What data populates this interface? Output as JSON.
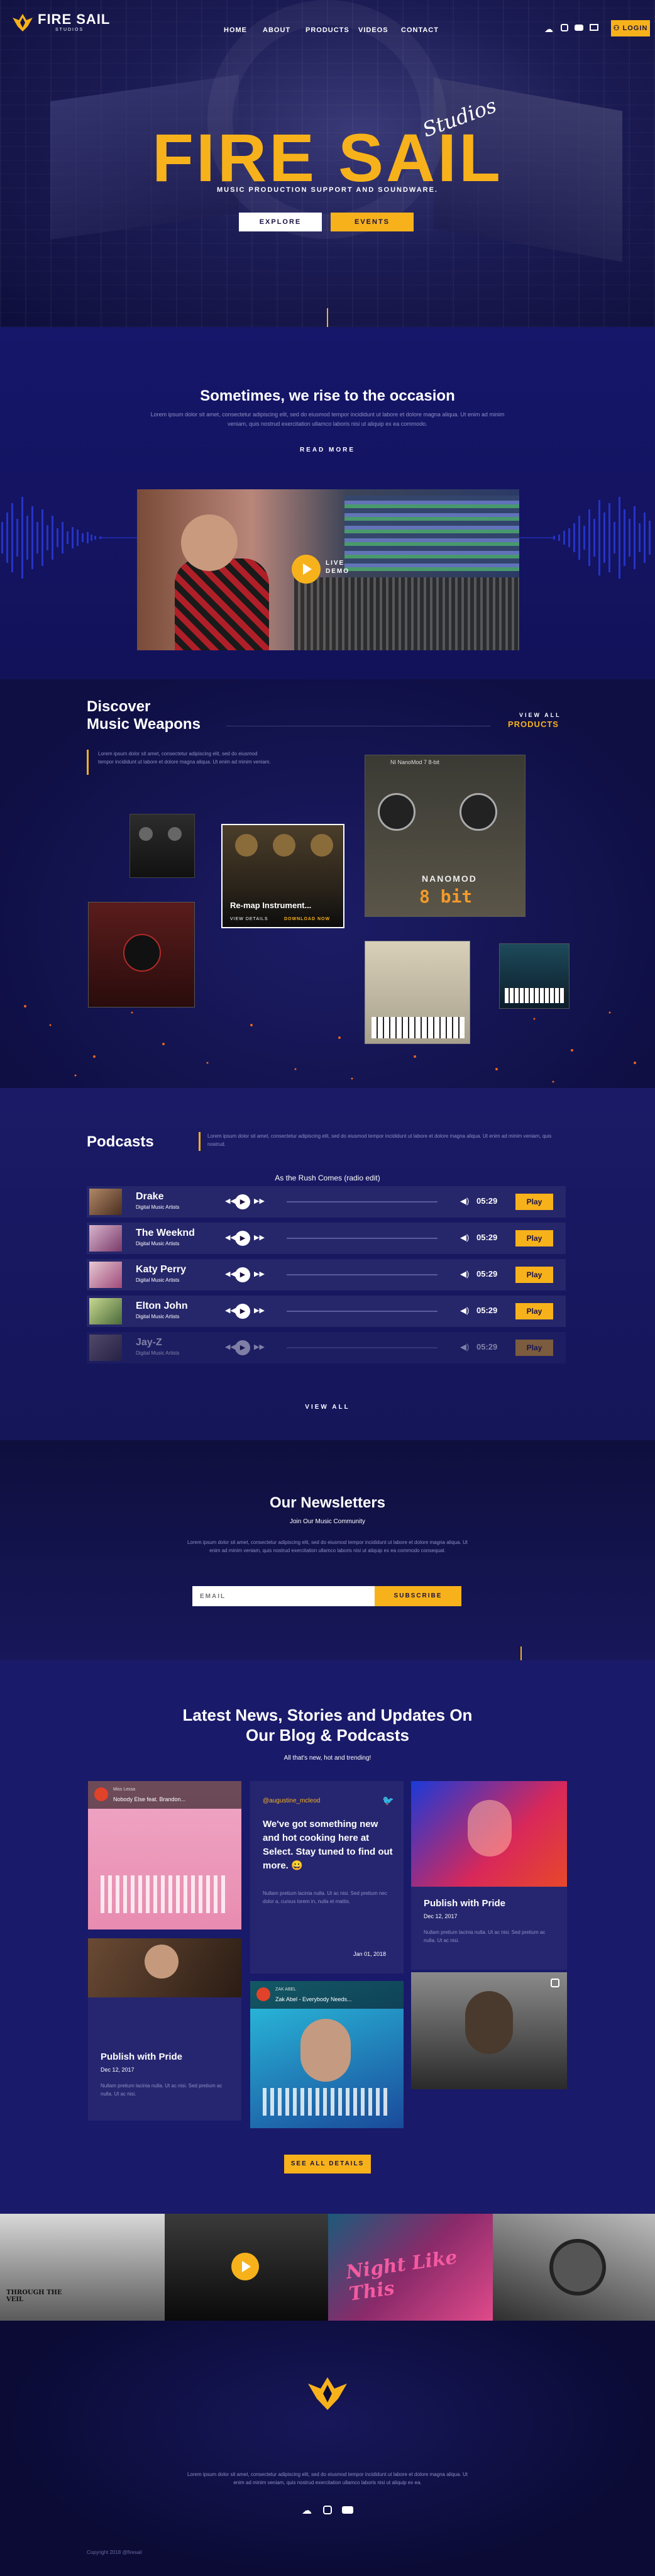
{
  "colors": {
    "accent": "#f7b21b",
    "background": "#11114a",
    "panel": "#262670",
    "wave": "#2b3be0"
  },
  "brand": {
    "name": "FIRE SAIL",
    "sub": "STUDIOS"
  },
  "nav": {
    "items": [
      "HOME",
      "ABOUT",
      "PRODUCTS",
      "VIDEOS",
      "CONTACT"
    ],
    "login": "LOGIN",
    "social_icons": [
      "soundcloud-icon",
      "instagram-icon",
      "youtube-icon",
      "mail-icon"
    ]
  },
  "hero": {
    "title": "FIRE SAIL",
    "script": "Studios",
    "subtitle": "MUSIC PRODUCTION SUPPORT AND SOUNDWARE.",
    "btn_explore": "EXPLORE",
    "btn_events": "EVENTS"
  },
  "rise": {
    "heading": "Sometimes, we rise to the occasion",
    "text": "Lorem ipsum dolor sit amet, consectetur adipiscing elit, sed do eiusmod tempor incididunt ut labore et dolore magna aliqua. Ut enim ad minim veniam, quis nostrud exercitation ullamco laboris nisi ut aliquip ex ea commodo.",
    "read_more": "READ MORE",
    "video_label_1": "LIVE",
    "video_label_2": "DEMO"
  },
  "weapons": {
    "heading_1": "Discover",
    "heading_2": "Music Weapons",
    "text": "Lorem ipsum dolor sit amet, consectetur adipiscing elit, sed do eiusmod tempor incididunt ut labore et dolore magna aliqua. Ut enim ad minim veniam.",
    "view_all_1": "VIEW ALL",
    "view_all_2": "PRODUCTS",
    "featured_title": "Re-map Instrument...",
    "featured_details": "VIEW DETAILS",
    "featured_download": "DOWNLOAD NOW",
    "plugin_brand": "NANOMOD",
    "plugin_brand_2": "8 bit",
    "plugin_header": "NI NanoMod 7 8-bit"
  },
  "podcasts": {
    "heading": "Podcasts",
    "text": "Lorem ipsum dolor sit amet, consectetur adipiscing elit, sed do eiusmod tempor incididunt ut labore et dolore magna aliqua. Ut enim ad minim veniam, quis nostrud.",
    "now_playing": "As the Rush Comes (radio edit)",
    "rows": [
      {
        "name": "Drake",
        "sub": "Digital Music Artists",
        "time": "05:29",
        "play": "Play"
      },
      {
        "name": "The Weeknd",
        "sub": "Digital Music Artists",
        "time": "05:29",
        "play": "Play"
      },
      {
        "name": "Katy Perry",
        "sub": "Digital Music Artists",
        "time": "05:29",
        "play": "Play"
      },
      {
        "name": "Elton John",
        "sub": "Digital Music Artists",
        "time": "05:29",
        "play": "Play"
      },
      {
        "name": "Jay-Z",
        "sub": "Digital Music Artists",
        "time": "05:29",
        "play": "Play"
      }
    ],
    "view_all": "VIEW ALL"
  },
  "newsletter": {
    "heading": "Our Newsletters",
    "sub": "Join Our Music Community",
    "text": "Lorem ipsum dolor sit amet, consectetur adipiscing elit, sed do eiusmod tempor incididunt ut labore et dolore magna aliqua. Ut enim ad minim veniam, quis nostrud exercitation ullamco laboris nisi ut aliquip ex ea commodo consequat.",
    "placeholder": "EMAIL",
    "button": "SUBSCRIBE"
  },
  "blog": {
    "heading_1": "Latest News, Stories and Updates On",
    "heading_2": "Our Blog & Podcasts",
    "sub": "All that's new, hot and trending!",
    "tweet_handle": "@augustine_mcleod",
    "tweet_text": "We've got something new and hot cooking here at Select. Stay tuned to find out more. 😀",
    "tweet_body": "Nullam pretium lacinia nulla. Ut ac nisi. Sed pretium nec dolor a, cursus lorem in, nulla et mattis.",
    "tweet_date": "Jan 01, 2018",
    "post_title": "Publish with Pride",
    "post_date": "Dec 12, 2017",
    "post_text": "Nullam pretium lacinia nulla. Ut ac nisi. Sed pretium ac nulla. Ut ac nisi.",
    "player_1_title": "Nobody Else feat. Brandon...",
    "player_1_artist": "Miss Lessa",
    "player_2_title": "Zak Abel - Everybody Needs...",
    "player_2_artist": "ZAK ABEL",
    "see_all": "SEE ALL DETAILS"
  },
  "gallery": {
    "album_1": "THROUGH THE VEIL",
    "album_3": "Night Like This"
  },
  "footer": {
    "text": "Lorem ipsum dolor sit amet, consectetur adipiscing elit, sed do eiusmod tempor incididunt ut labore et dolore magna aliqua. Ut enim ad minim veniam, quis nostrud exercitation ullamco laboris nisi ut aliquip ex ea.",
    "copyright": "Copyright 2018 @firesail"
  }
}
